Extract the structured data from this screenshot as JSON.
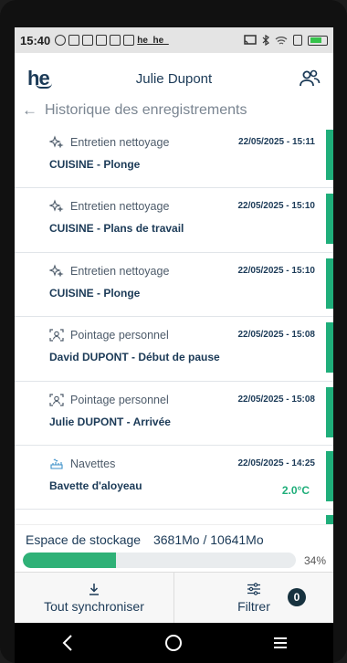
{
  "status_bar": {
    "time": "15:40",
    "brand_text": "he_he_"
  },
  "header": {
    "logo": "he",
    "user_name": "Julie Dupont"
  },
  "page": {
    "title": "Historique des enregistrements"
  },
  "records": [
    {
      "category": "Entretien nettoyage",
      "category_icon": "sparkle-icon",
      "datetime": "22/05/2025 - 15:11",
      "label": "CUISINE - Plonge"
    },
    {
      "category": "Entretien nettoyage",
      "category_icon": "sparkle-icon",
      "datetime": "22/05/2025 - 15:10",
      "label": "CUISINE - Plans de travail"
    },
    {
      "category": "Entretien nettoyage",
      "category_icon": "sparkle-icon",
      "datetime": "22/05/2025 - 15:10",
      "label": "CUISINE - Plonge"
    },
    {
      "category": "Pointage personnel",
      "category_icon": "person-scan-icon",
      "datetime": "22/05/2025 - 15:08",
      "label": "David DUPONT - Début de pause"
    },
    {
      "category": "Pointage personnel",
      "category_icon": "person-scan-icon",
      "datetime": "22/05/2025 - 15:08",
      "label": "Julie DUPONT - Arrivée"
    },
    {
      "category": "Navettes",
      "category_icon": "shuttle-icon",
      "datetime": "22/05/2025 - 14:25",
      "label": "Bavette d'aloyeau",
      "temperature": "2.0°C"
    }
  ],
  "storage": {
    "label": "Espace de stockage",
    "value": "3681Mo / 10641Mo",
    "percent_text": "34%",
    "percent": 0.34
  },
  "actions": {
    "sync_label": "Tout synchroniser",
    "filter_label": "Filtrer",
    "filter_count": "0"
  },
  "colors": {
    "accent": "#1fae7a",
    "primary": "#1b3a57"
  }
}
